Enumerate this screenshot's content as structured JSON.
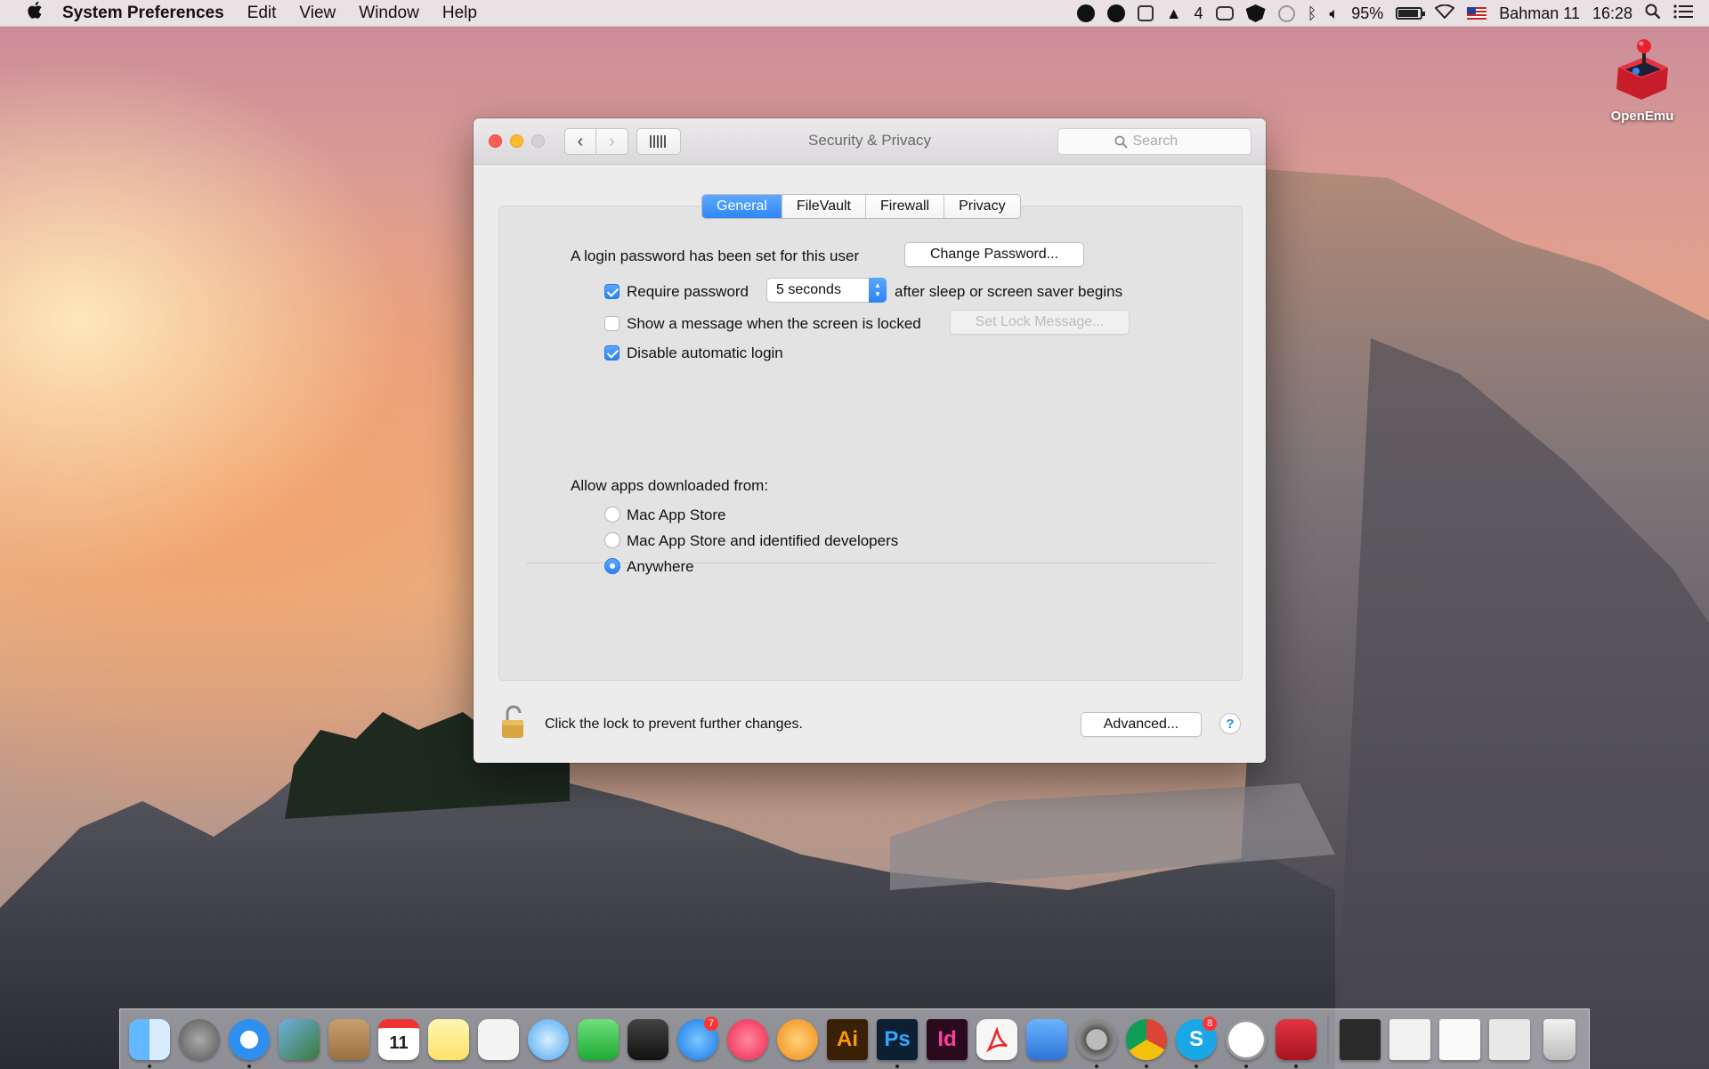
{
  "menubar": {
    "app_name": "System Preferences",
    "menus": [
      "Edit",
      "View",
      "Window",
      "Help"
    ],
    "status": {
      "notification_count": "4",
      "battery": "95%",
      "date": "Bahman 11",
      "time": "16:28"
    }
  },
  "desktop": {
    "icons": [
      {
        "label": "OpenEmu",
        "icon": "openemu-icon"
      }
    ]
  },
  "window": {
    "title": "Security & Privacy",
    "search_placeholder": "Search",
    "tabs": [
      {
        "label": "General",
        "active": true
      },
      {
        "label": "FileVault",
        "active": false
      },
      {
        "label": "Firewall",
        "active": false
      },
      {
        "label": "Privacy",
        "active": false
      }
    ],
    "general": {
      "login_password_text": "A login password has been set for this user",
      "change_password_label": "Change Password...",
      "require_password": {
        "label": "Require password",
        "checked": true
      },
      "require_password_delay": "5 seconds",
      "after_sleep_text": "after sleep or screen saver begins",
      "show_message": {
        "label": "Show a message when the screen is locked",
        "checked": false
      },
      "set_lock_message_label": "Set Lock Message...",
      "disable_auto_login": {
        "label": "Disable automatic login",
        "checked": true
      },
      "allow_apps_heading": "Allow apps downloaded from:",
      "allow_apps_options": [
        {
          "label": "Mac App Store",
          "selected": false
        },
        {
          "label": "Mac App Store and identified developers",
          "selected": false
        },
        {
          "label": "Anywhere",
          "selected": true
        }
      ]
    },
    "footer": {
      "lock_text": "Click the lock to prevent further changes.",
      "advanced_label": "Advanced...",
      "help_label": "?"
    }
  },
  "dock": {
    "calendar_day": "11",
    "app_store_badge": "7",
    "skype_badge": "8",
    "tile_labels": {
      "illustrator": "Ai",
      "photoshop": "Ps",
      "indesign": "Id",
      "skype": "S"
    }
  },
  "colors": {
    "accent": "#2f86f7",
    "close": "#fc5d57",
    "minimize": "#fdbc2e"
  }
}
